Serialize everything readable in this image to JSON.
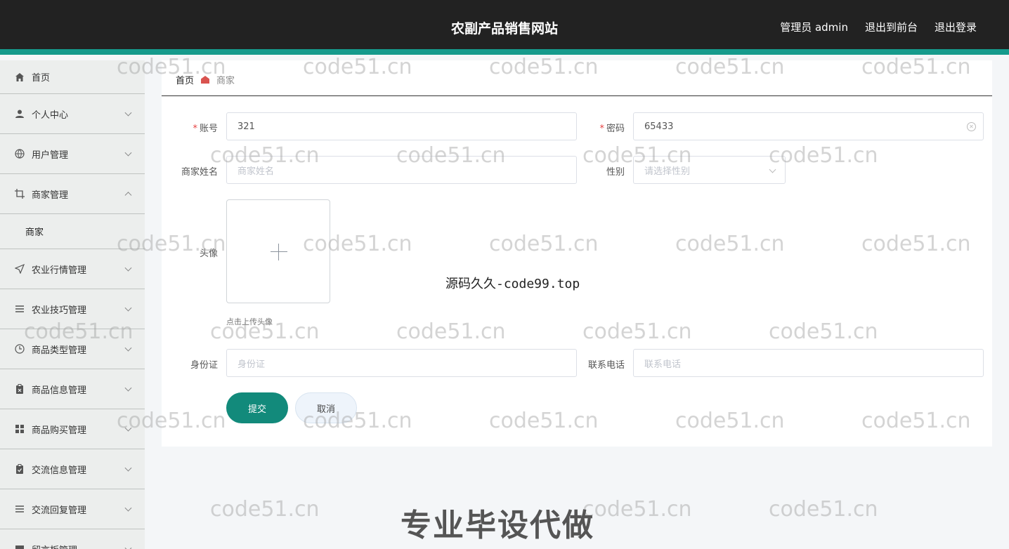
{
  "header": {
    "title": "农副产品销售网站",
    "admin_label": "管理员 admin",
    "front_label": "退出到前台",
    "logout_label": "退出登录"
  },
  "sidebar": {
    "items": [
      {
        "label": "首页",
        "icon": "home-icon"
      },
      {
        "label": "个人中心",
        "icon": "user-icon"
      },
      {
        "label": "用户管理",
        "icon": "globe-icon"
      },
      {
        "label": "商家管理",
        "icon": "crop-icon",
        "expanded": true,
        "children": [
          "商家"
        ]
      },
      {
        "label": "农业行情管理",
        "icon": "send-icon"
      },
      {
        "label": "农业技巧管理",
        "icon": "list-icon"
      },
      {
        "label": "商品类型管理",
        "icon": "clock-icon"
      },
      {
        "label": "商品信息管理",
        "icon": "clipboard-icon"
      },
      {
        "label": "商品购买管理",
        "icon": "grid-icon"
      },
      {
        "label": "交流信息管理",
        "icon": "clipboard-check-icon"
      },
      {
        "label": "交流回复管理",
        "icon": "list-icon"
      },
      {
        "label": "留言板管理",
        "icon": "message-icon"
      }
    ]
  },
  "breadcrumb": {
    "home": "首页",
    "current": "商家"
  },
  "form": {
    "account": {
      "label": "账号",
      "value": "321"
    },
    "password": {
      "label": "密码",
      "value": "65433"
    },
    "name": {
      "label": "商家姓名",
      "placeholder": "商家姓名"
    },
    "gender": {
      "label": "性别",
      "placeholder": "请选择性别"
    },
    "avatar": {
      "label": "头像",
      "hint": "点击上传头像"
    },
    "id_card": {
      "label": "身份证",
      "placeholder": "身份证"
    },
    "phone": {
      "label": "联系电话",
      "placeholder": "联系电话"
    },
    "submit_label": "提交",
    "cancel_label": "取消"
  },
  "overlay": {
    "watermark": "code51.cn",
    "center_text": "源码久久-code99.top",
    "bottom_text": "专业毕设代做"
  }
}
